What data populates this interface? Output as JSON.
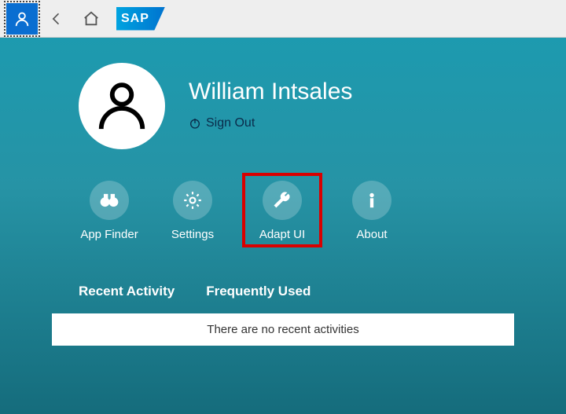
{
  "header": {
    "sap_logo_text": "SAP"
  },
  "profile": {
    "username": "William Intsales",
    "signout_label": "Sign Out"
  },
  "actions": {
    "app_finder": "App Finder",
    "settings": "Settings",
    "adapt_ui": "Adapt UI",
    "about": "About"
  },
  "sections": {
    "recent_activity": "Recent Activity",
    "frequently_used": "Frequently Used"
  },
  "empty_state": "There are no recent activities"
}
